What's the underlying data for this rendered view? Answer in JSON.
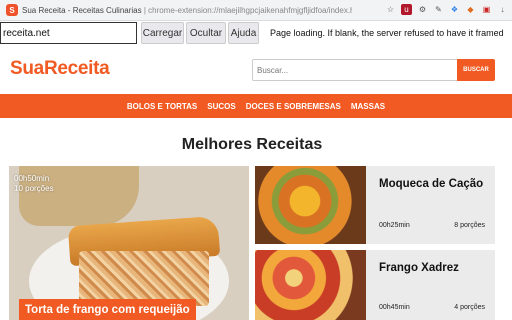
{
  "browser": {
    "tab_title": "Sua Receita - Receitas Culinarias",
    "url": "chrome-extension://mlaejilhgpcjaikenahfmjgfljidfoa/index.html",
    "extension_icons": [
      "u",
      "⚙",
      "✎",
      "❖",
      "◆",
      "▣",
      "↓"
    ]
  },
  "extension": {
    "url_value": "receita.net",
    "load_label": "Carregar",
    "hide_label": "Ocultar",
    "help_label": "Ajuda",
    "message": "Page loading. If blank, the server refused to have it framed"
  },
  "site": {
    "logo": "SuaReceita",
    "search_placeholder": "Buscar...",
    "search_button": "BUSCAR",
    "nav": [
      "BOLOS E TORTAS",
      "SUCOS",
      "DOCES E SOBREMESAS",
      "MASSAS"
    ],
    "section_title": "Melhores Receitas",
    "brand_color": "#f15a22"
  },
  "featured": {
    "time": "00h50min",
    "servings": "10 porções",
    "title": "Torta de frango com requeijão"
  },
  "recipes": [
    {
      "title": "Moqueca de Cação",
      "time": "00h25min",
      "servings": "8 porções"
    },
    {
      "title": "Frango Xadrez",
      "time": "00h45min",
      "servings": "4 porções"
    }
  ]
}
